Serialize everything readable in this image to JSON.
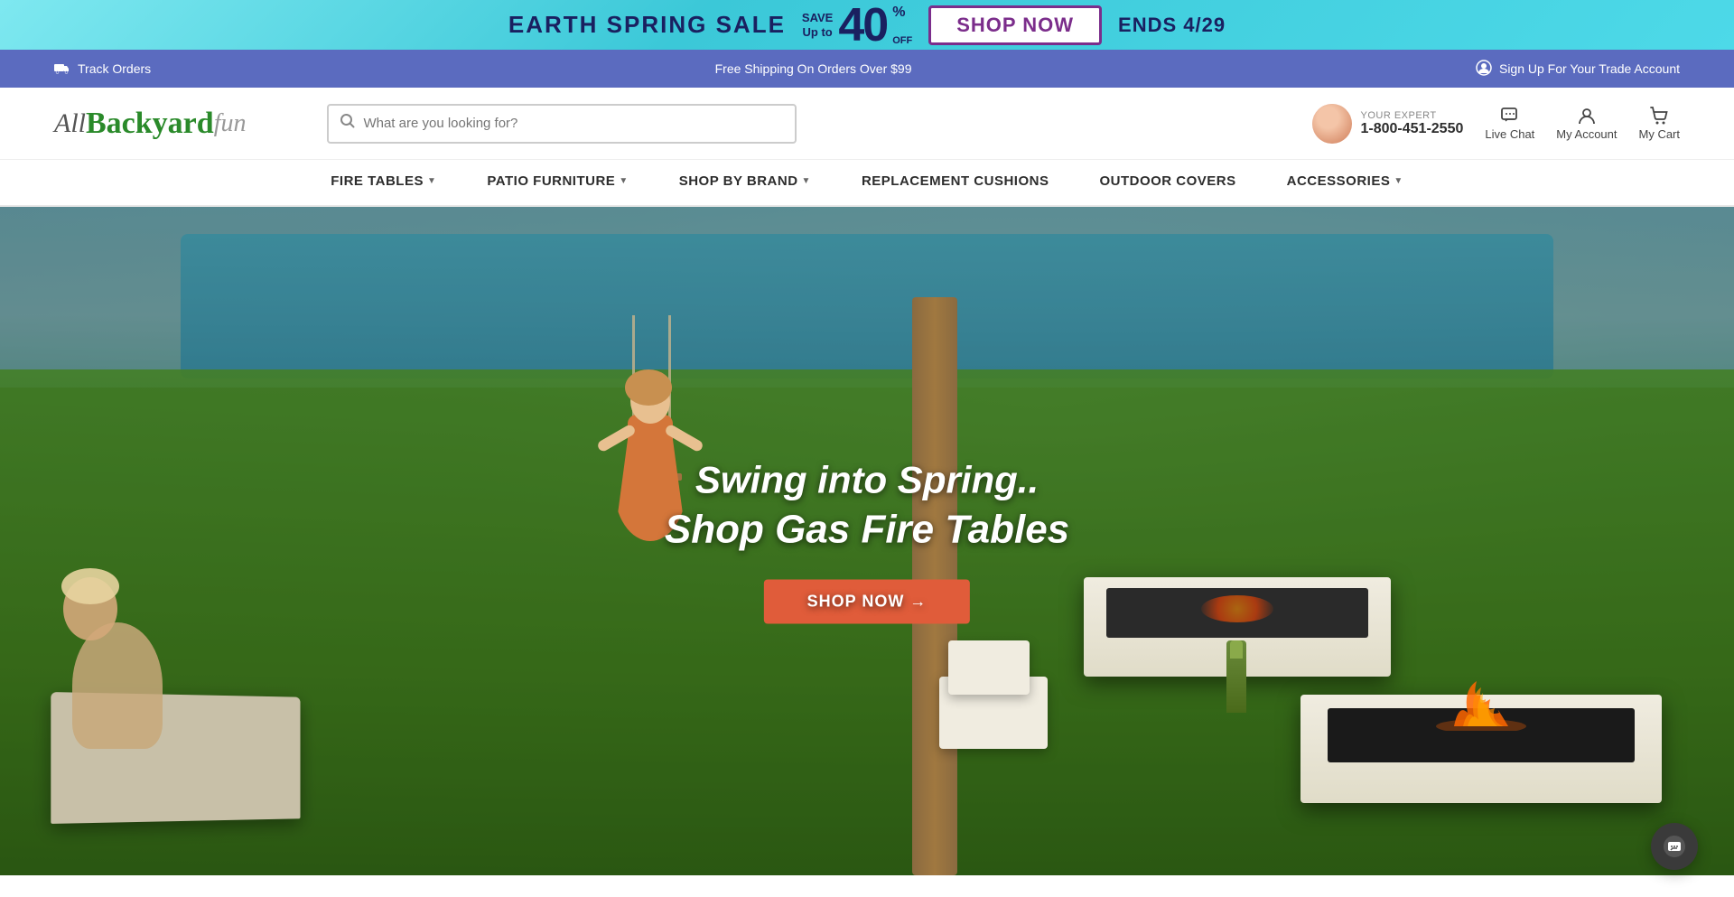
{
  "topBanner": {
    "sale_label": "EARTH SPRING SALE",
    "save_label": "SAVE",
    "save_amount": "40",
    "save_unit": "%",
    "save_subtitle": "Up to",
    "off_label": "OFF",
    "cta_label": "SHOP NOW",
    "ends_label": "ENDS 4/29"
  },
  "infoBar": {
    "track_icon": "truck-icon",
    "track_label": "Track Orders",
    "shipping_label": "Free Shipping On Orders Over $99",
    "trade_icon": "user-icon",
    "trade_label": "Sign Up For Your Trade Account"
  },
  "header": {
    "logo": {
      "all": "All",
      "backyard": "Backyard",
      "fun": "fun"
    },
    "search_placeholder": "What are you looking for?",
    "expert_label": "YOUR EXPERT",
    "phone": "1-800-451-2550",
    "live_chat_label": "Live Chat",
    "my_account_label": "My Account",
    "my_cart_label": "My Cart"
  },
  "nav": {
    "items": [
      {
        "label": "FIRE TABLES",
        "has_dropdown": true
      },
      {
        "label": "PATIO FURNITURE",
        "has_dropdown": true
      },
      {
        "label": "SHOP BY BRAND",
        "has_dropdown": true
      },
      {
        "label": "REPLACEMENT CUSHIONS",
        "has_dropdown": false
      },
      {
        "label": "OUTDOOR COVERS",
        "has_dropdown": false
      },
      {
        "label": "ACCESSORIES",
        "has_dropdown": true
      }
    ]
  },
  "hero": {
    "title_line1": "Swing into Spring..",
    "title_line2": "Shop Gas Fire Tables",
    "cta_label": "SHOP NOW →"
  },
  "colors": {
    "accent": "#e05c3a",
    "nav_bg": "#ffffff",
    "info_bar_bg": "#5b6bbf",
    "banner_bg": "#4dd9e8",
    "hero_cta": "#e05c3a"
  }
}
